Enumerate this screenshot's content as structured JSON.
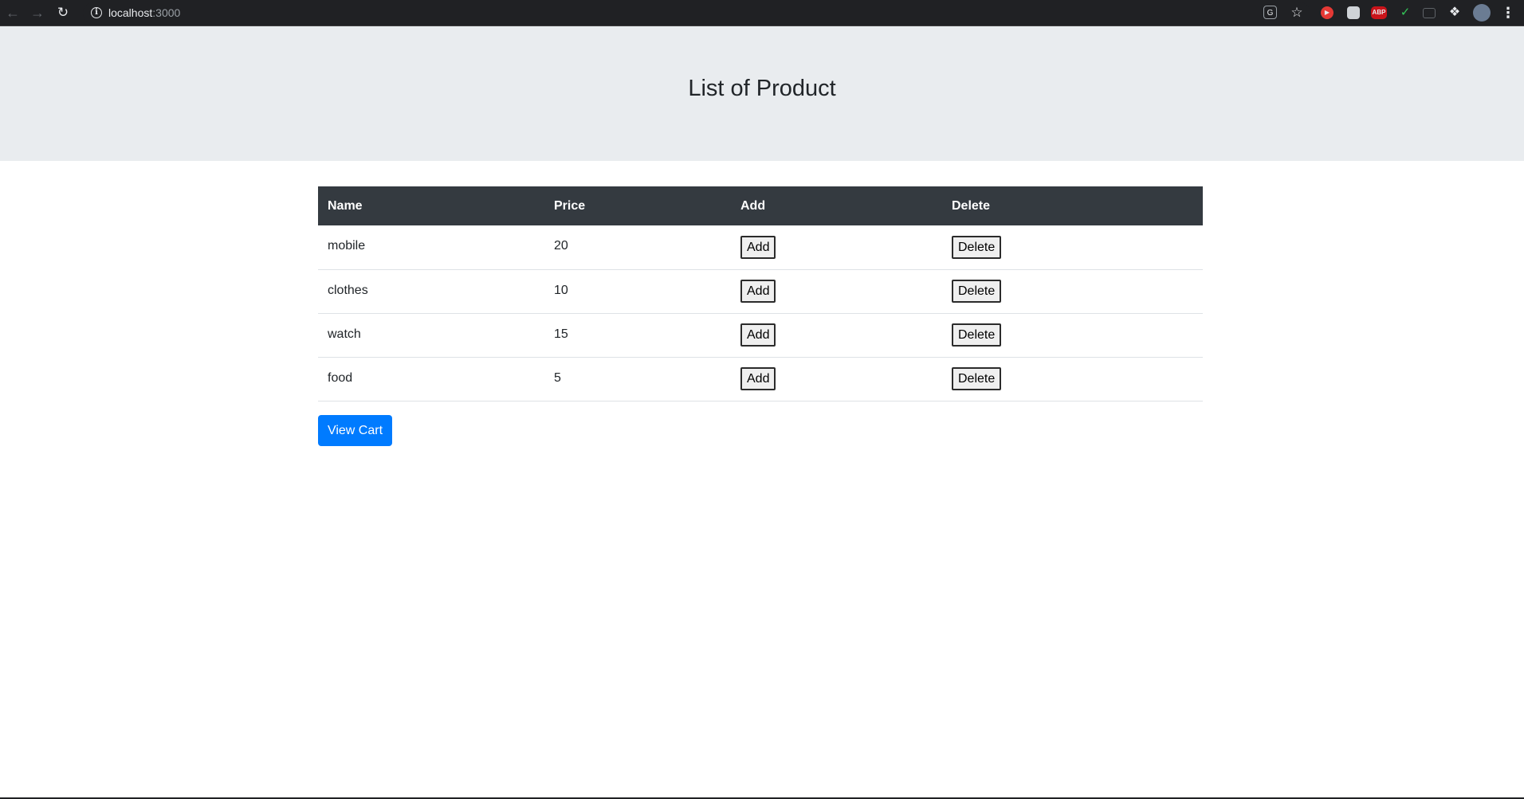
{
  "browser": {
    "url_host": "localhost",
    "url_port": ":3000",
    "icons": {
      "back": "arrow-left-icon",
      "forward": "arrow-right-icon",
      "reload": "reload-icon",
      "info": "info-icon",
      "translate": "translate-icon",
      "bookmark": "star-icon",
      "extensions": "puzzle-icon",
      "menu": "kebab-menu-icon"
    },
    "abp_label": "ABP"
  },
  "header": {
    "title": "List of Product"
  },
  "table": {
    "columns": [
      "Name",
      "Price",
      "Add",
      "Delete"
    ],
    "rows": [
      {
        "name": "mobile",
        "price": "20",
        "add_label": "Add",
        "delete_label": "Delete"
      },
      {
        "name": "clothes",
        "price": "10",
        "add_label": "Add",
        "delete_label": "Delete"
      },
      {
        "name": "watch",
        "price": "15",
        "add_label": "Add",
        "delete_label": "Delete"
      },
      {
        "name": "food",
        "price": "5",
        "add_label": "Add",
        "delete_label": "Delete"
      }
    ]
  },
  "actions": {
    "view_cart_label": "View Cart"
  },
  "colors": {
    "jumbotron_bg": "#e9ecef",
    "table_header_bg": "#343a40",
    "primary": "#007bff"
  }
}
